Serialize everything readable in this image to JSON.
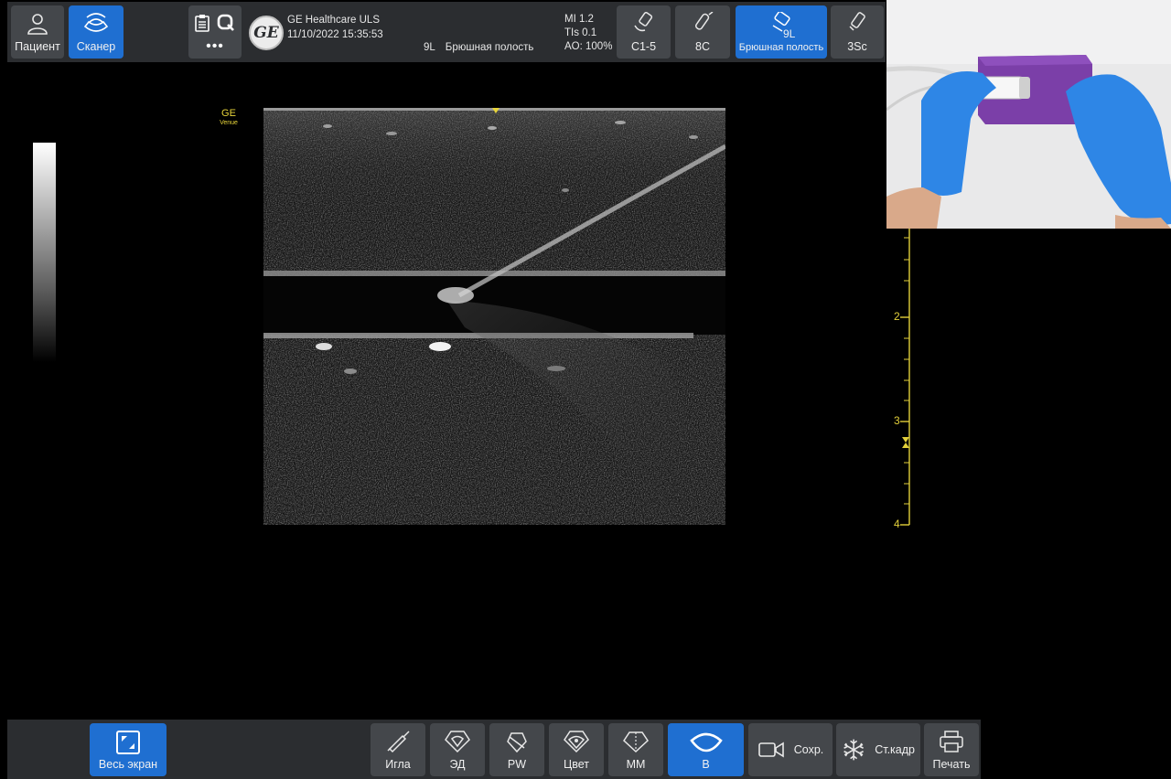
{
  "topbar": {
    "patient_label": "Пациент",
    "scanner_label": "Сканер",
    "more_label": "•••",
    "ge_logo_text": "GE",
    "facility": "GE Healthcare ULS",
    "datetime": "11/10/2022 15:35:53",
    "active_probe": "9L",
    "preset": "Брюшная полость",
    "mi": "MI 1.2",
    "tis": "TIs 0.1",
    "ao": "AO: 100%",
    "probes": [
      {
        "id": "C1-5",
        "label": "C1-5",
        "preset": ""
      },
      {
        "id": "8C",
        "label": "8C",
        "preset": ""
      },
      {
        "id": "9L",
        "label": "9L",
        "preset": "Брюшная полость",
        "active": true
      },
      {
        "id": "3Sc",
        "label": "3Sc",
        "preset": ""
      }
    ]
  },
  "image": {
    "brand_line1": "GE",
    "brand_line2": "Venue",
    "depth_labels": [
      "2",
      "3",
      "4"
    ]
  },
  "bottombar": {
    "fullscreen_label": "Весь экран",
    "needle_label": "Игла",
    "power_doppler_label": "ЭД",
    "pw_label": "PW",
    "color_label": "Цвет",
    "mm_label": "MM",
    "b_label": "B",
    "save_label": "Сохр.",
    "freeze_label": "Ст.кадр",
    "print_label": "Печать"
  },
  "colors": {
    "accent": "#1f6fd1",
    "bar_bg": "#2b2d30",
    "button_bg": "#44474b",
    "annotation_yellow": "#e2cf3a"
  }
}
